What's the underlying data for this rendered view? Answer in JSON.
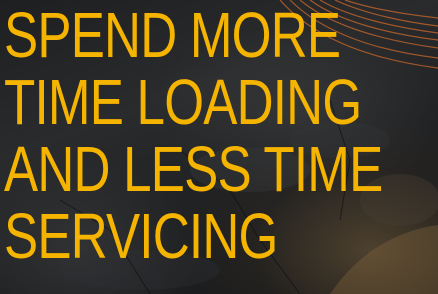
{
  "headline": {
    "lines": [
      "SPEND MORE",
      "TIME LOADING",
      "AND LESS TIME",
      "SERVICING"
    ]
  },
  "colors": {
    "headline_text": "#f5b400",
    "background": "#1a1b1d"
  }
}
